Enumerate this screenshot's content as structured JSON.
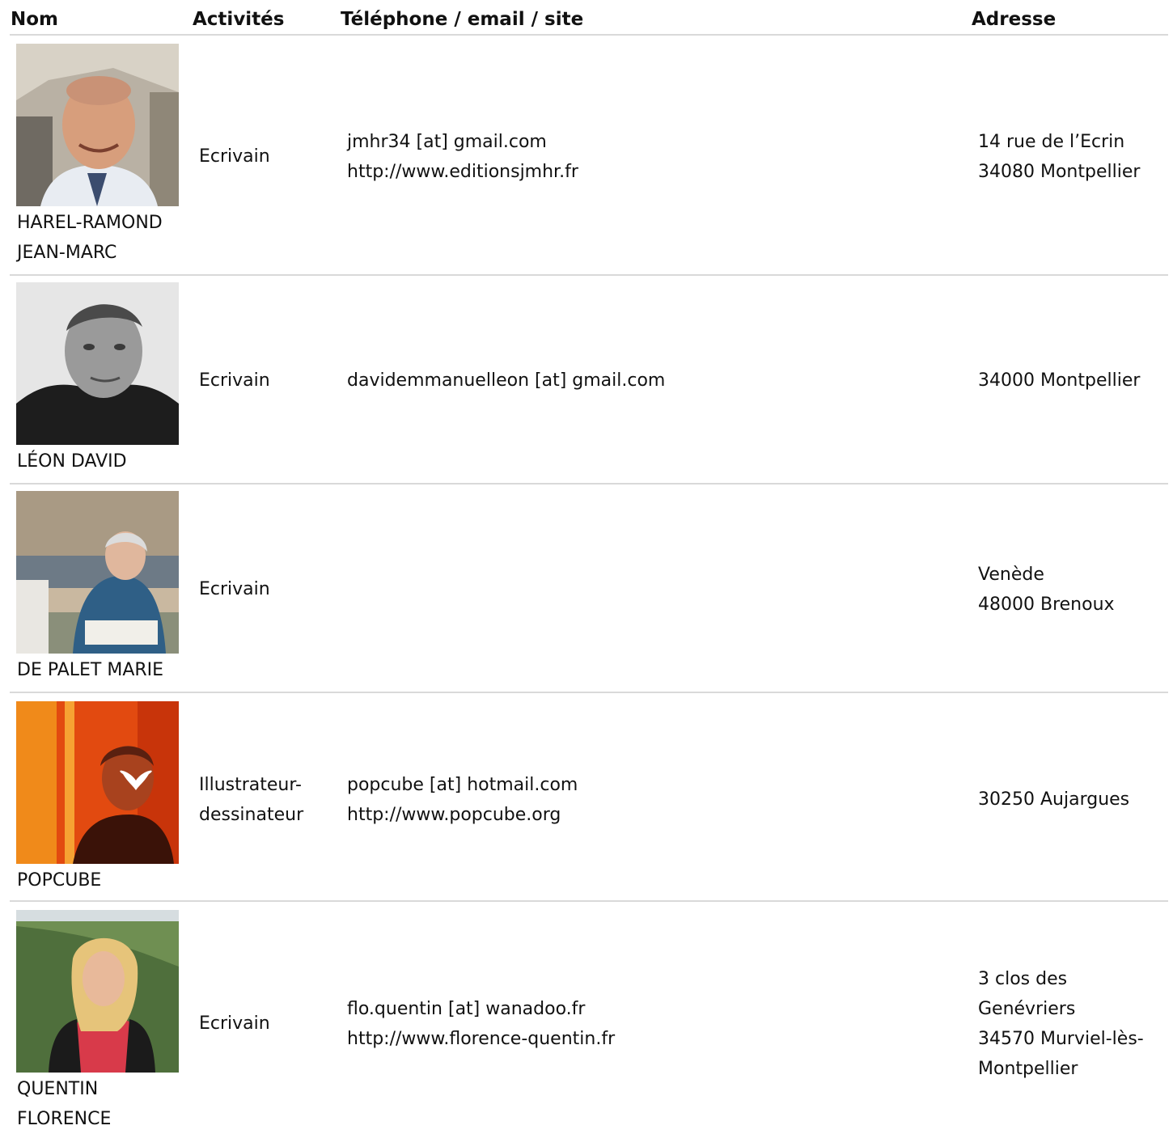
{
  "header": {
    "name": "Nom",
    "activities": "Activités",
    "contact": "Téléphone / email / site",
    "address": "Adresse"
  },
  "rows": [
    {
      "name_lines": [
        "HAREL-RAMOND",
        "JEAN-MARC"
      ],
      "activity_lines": [
        "Ecrivain"
      ],
      "contact_lines": [
        "jmhr34 [at] gmail.com",
        "http://www.editionsjmhr.fr"
      ],
      "address_lines": [
        "14 rue de l’Ecrin",
        "34080 Montpellier"
      ]
    },
    {
      "name_lines": [
        "LÉON DAVID"
      ],
      "activity_lines": [
        "Ecrivain"
      ],
      "contact_lines": [
        "davidemmanuelleon [at] gmail.com"
      ],
      "address_lines": [
        "34000 Montpellier"
      ]
    },
    {
      "name_lines": [
        "DE PALET MARIE"
      ],
      "activity_lines": [
        "Ecrivain"
      ],
      "contact_lines": [],
      "address_lines": [
        "Venède",
        "48000 Brenoux"
      ]
    },
    {
      "name_lines": [
        "POPCUBE"
      ],
      "activity_lines": [
        "Illustrateur-",
        "dessinateur"
      ],
      "contact_lines": [
        "popcube [at] hotmail.com",
        "http://www.popcube.org"
      ],
      "address_lines": [
        "30250 Aujargues"
      ]
    },
    {
      "name_lines": [
        "QUENTIN",
        "FLORENCE"
      ],
      "activity_lines": [
        "Ecrivain"
      ],
      "contact_lines": [
        "flo.quentin [at] wanadoo.fr",
        "http://www.florence-quentin.fr"
      ],
      "address_lines": [
        "3 clos des",
        "Genévriers",
        "34570 Murviel-lès-",
        "Montpellier"
      ]
    }
  ]
}
